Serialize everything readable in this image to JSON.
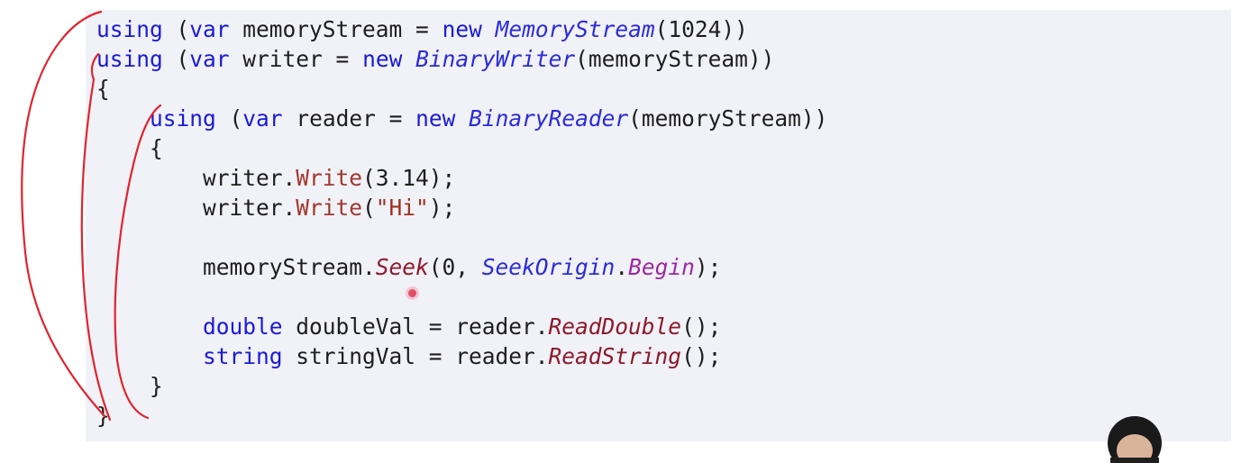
{
  "code": {
    "lines": [
      [
        {
          "t": "using",
          "c": "kw"
        },
        {
          "t": " (",
          "c": "plain"
        },
        {
          "t": "var",
          "c": "kw"
        },
        {
          "t": " memoryStream = ",
          "c": "plain"
        },
        {
          "t": "new",
          "c": "kw"
        },
        {
          "t": " ",
          "c": "plain"
        },
        {
          "t": "MemoryStream",
          "c": "type"
        },
        {
          "t": "(1024))",
          "c": "plain"
        }
      ],
      [
        {
          "t": "using",
          "c": "kw"
        },
        {
          "t": " (",
          "c": "plain"
        },
        {
          "t": "var",
          "c": "kw"
        },
        {
          "t": " writer = ",
          "c": "plain"
        },
        {
          "t": "new",
          "c": "kw"
        },
        {
          "t": " ",
          "c": "plain"
        },
        {
          "t": "BinaryWriter",
          "c": "type"
        },
        {
          "t": "(memoryStream))",
          "c": "plain"
        }
      ],
      [
        {
          "t": "{",
          "c": "plain"
        }
      ],
      [
        {
          "t": "    ",
          "c": "plain"
        },
        {
          "t": "using",
          "c": "kw"
        },
        {
          "t": " (",
          "c": "plain"
        },
        {
          "t": "var",
          "c": "kw"
        },
        {
          "t": " reader = ",
          "c": "plain"
        },
        {
          "t": "new",
          "c": "kw"
        },
        {
          "t": " ",
          "c": "plain"
        },
        {
          "t": "BinaryReader",
          "c": "type"
        },
        {
          "t": "(memoryStream))",
          "c": "plain"
        }
      ],
      [
        {
          "t": "    {",
          "c": "plain"
        }
      ],
      [
        {
          "t": "        writer.",
          "c": "plain"
        },
        {
          "t": "Write",
          "c": "meth-up"
        },
        {
          "t": "(3.14);",
          "c": "plain"
        }
      ],
      [
        {
          "t": "        writer.",
          "c": "plain"
        },
        {
          "t": "Write",
          "c": "meth-up"
        },
        {
          "t": "(",
          "c": "plain"
        },
        {
          "t": "\"Hi\"",
          "c": "str"
        },
        {
          "t": ");",
          "c": "plain"
        }
      ],
      [
        {
          "t": "",
          "c": "plain"
        }
      ],
      [
        {
          "t": "        memoryStream.",
          "c": "plain"
        },
        {
          "t": "Seek",
          "c": "meth"
        },
        {
          "t": "(0, ",
          "c": "plain"
        },
        {
          "t": "SeekOrigin",
          "c": "type"
        },
        {
          "t": ".",
          "c": "plain"
        },
        {
          "t": "Begin",
          "c": "enumv"
        },
        {
          "t": ");",
          "c": "plain"
        }
      ],
      [
        {
          "t": "",
          "c": "plain"
        }
      ],
      [
        {
          "t": "        ",
          "c": "plain"
        },
        {
          "t": "double",
          "c": "kw"
        },
        {
          "t": " doubleVal = reader.",
          "c": "plain"
        },
        {
          "t": "ReadDouble",
          "c": "meth"
        },
        {
          "t": "();",
          "c": "plain"
        }
      ],
      [
        {
          "t": "        ",
          "c": "plain"
        },
        {
          "t": "string",
          "c": "kw"
        },
        {
          "t": " stringVal = reader.",
          "c": "plain"
        },
        {
          "t": "ReadString",
          "c": "meth"
        },
        {
          "t": "();",
          "c": "plain"
        }
      ],
      [
        {
          "t": "    }",
          "c": "plain"
        }
      ],
      [
        {
          "t": "}",
          "c": "plain"
        }
      ]
    ]
  },
  "colors": {
    "panel_background": "#f1f1f8",
    "keyword": "#1a1ad8",
    "type": "#2b2bd8",
    "method": "#8c1a2a",
    "enum_value": "#9a2aa0",
    "string": "#a03020",
    "annotation_ink": "#e0242c",
    "pointer": "#e0506a"
  },
  "icons": {
    "pointer": "laser-pointer-dot",
    "presenter": "presenter-webcam-avatar"
  }
}
